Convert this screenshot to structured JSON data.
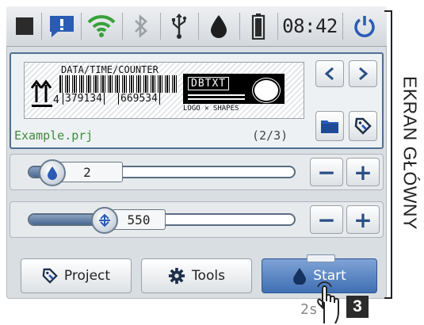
{
  "status_bar": {
    "time": "08:42",
    "icons": [
      "stop-square-icon",
      "message-alert-icon",
      "wifi-icon",
      "bluetooth-icon",
      "usb-icon",
      "ink-drop-icon",
      "battery-icon",
      "power-icon"
    ],
    "colors": {
      "alert": "#2a5bb5",
      "wifi_active": "#37a13a",
      "bluetooth_inactive": "#9aa0a6"
    }
  },
  "preview": {
    "label_text": "DATA/TIME/COUNTER",
    "barcode_number_prefix": "4",
    "barcode_number_1": "379134",
    "barcode_number_2": "669534",
    "logo_text": "DBTXT",
    "shapes_caption": "LOGO ✕ SHAPES",
    "project_name": "Example.prj",
    "project_index": "(2/3)"
  },
  "sliders": {
    "ink": {
      "value": "2",
      "level": 0.12
    },
    "speed": {
      "value": "550",
      "level": 0.33
    },
    "minus_label": "−",
    "plus_label": "+"
  },
  "buttons": {
    "project": "Project",
    "tools": "Tools",
    "start": "Start"
  },
  "side_label": "EKRAN GŁÓWNY",
  "hint": {
    "duration": "2s",
    "step": "3"
  },
  "accent": "#3f6fb3"
}
